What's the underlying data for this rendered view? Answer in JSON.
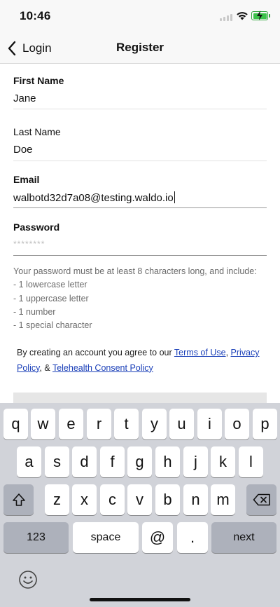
{
  "status_bar": {
    "time": "10:46"
  },
  "nav": {
    "back_label": "Login",
    "title": "Register"
  },
  "form": {
    "first_name": {
      "label": "First Name",
      "value": "Jane"
    },
    "last_name": {
      "label": "Last Name",
      "value": "Doe"
    },
    "email": {
      "label": "Email",
      "value": "walbotd32d7a08@testing.waldo.io"
    },
    "password": {
      "label": "Password",
      "placeholder": "********"
    }
  },
  "password_hint": {
    "intro": "Your password must be at least 8 characters long, and include:",
    "rules": [
      "- 1 lowercase letter",
      "- 1 uppercase letter",
      "- 1 number",
      "- 1 special character"
    ]
  },
  "terms": {
    "prefix": "By creating an account you agree to our ",
    "terms_link": "Terms of Use",
    "sep1": ", ",
    "privacy_link": "Privacy Policy",
    "sep2": ", & ",
    "telehealth_link": "Telehealth Consent Policy"
  },
  "keyboard": {
    "row1": [
      "q",
      "w",
      "e",
      "r",
      "t",
      "y",
      "u",
      "i",
      "o",
      "p"
    ],
    "row2": [
      "a",
      "s",
      "d",
      "f",
      "g",
      "h",
      "j",
      "k",
      "l"
    ],
    "row3": [
      "z",
      "x",
      "c",
      "v",
      "b",
      "n",
      "m"
    ],
    "numbers_key": "123",
    "space_key": "space",
    "at_key": "@",
    "period_key": ".",
    "next_key": "next"
  }
}
